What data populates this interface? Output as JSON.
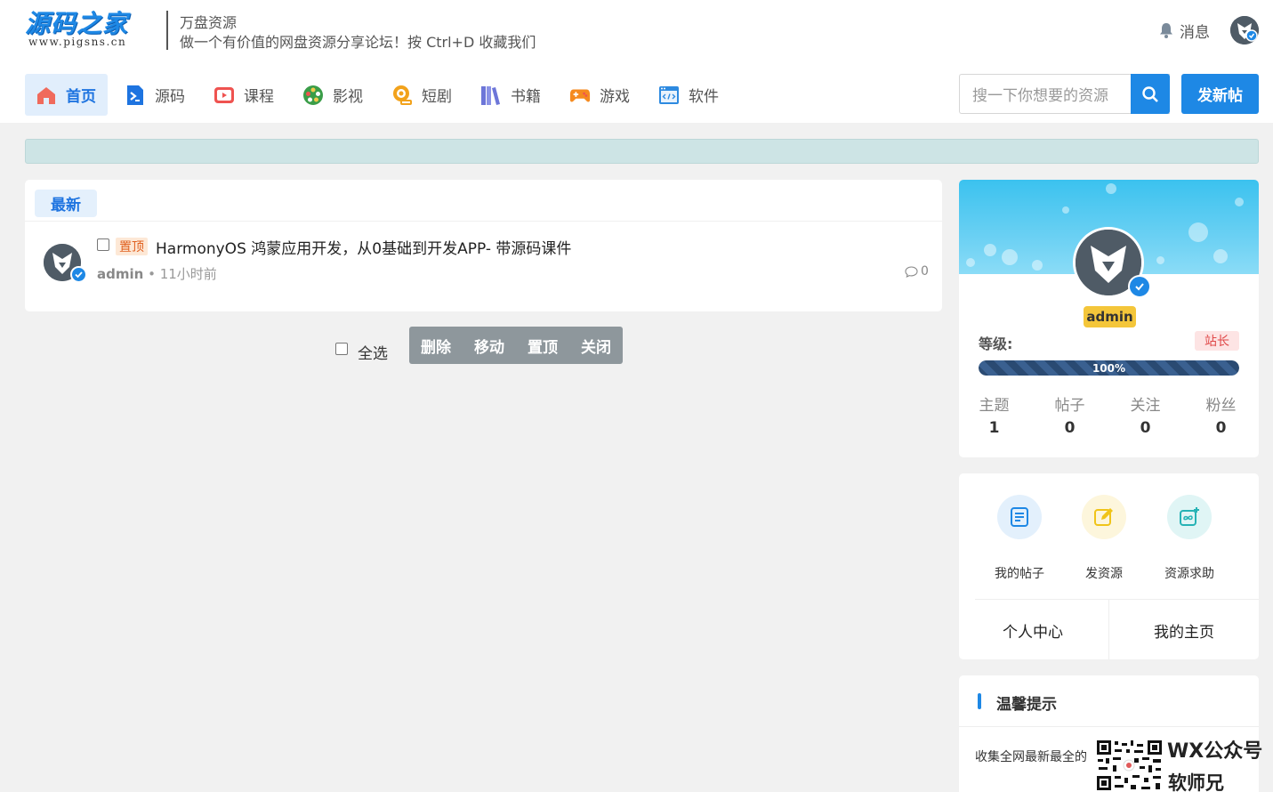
{
  "logo": {
    "main": "源码之家",
    "sub": "www.pigsns.cn"
  },
  "site": {
    "name": "万盘资源",
    "slogan": "做一个有价值的网盘资源分享论坛！按 Ctrl+D 收藏我们"
  },
  "header": {
    "messages_label": "消息"
  },
  "nav": [
    {
      "label": "首页",
      "icon": "home-icon",
      "active": true,
      "color": "#f06a5c"
    },
    {
      "label": "源码",
      "icon": "terminal-icon",
      "color": "#1e74e0"
    },
    {
      "label": "课程",
      "icon": "video-play-icon",
      "color": "#ef5350"
    },
    {
      "label": "影视",
      "icon": "film-reel-icon",
      "color": "#3a9d48"
    },
    {
      "label": "短剧",
      "icon": "camera-icon",
      "color": "#f2a21b"
    },
    {
      "label": "书籍",
      "icon": "books-icon",
      "color": "#6d76d8"
    },
    {
      "label": "游戏",
      "icon": "gamepad-icon",
      "color": "#f58a1f"
    },
    {
      "label": "软件",
      "icon": "code-window-icon",
      "color": "#2d8ae0"
    }
  ],
  "search": {
    "placeholder": "搜一下你想要的资源"
  },
  "post_button": "发新帖",
  "list": {
    "tab": "最新",
    "threads": [
      {
        "pin_label": "置顶",
        "title": "HarmonyOS 鸿蒙应用开发，从0基础到开发APP- 带源码课件",
        "author": "admin",
        "time": "11小时前",
        "comments": "0"
      }
    ]
  },
  "bulk": {
    "select_all": "全选",
    "actions": [
      "删除",
      "移动",
      "置顶",
      "关闭"
    ]
  },
  "profile": {
    "name": "admin",
    "level_label": "等级:",
    "role": "站长",
    "progress_text": "100%",
    "progress_value": 1.0,
    "stats": [
      {
        "label": "主题",
        "value": "1"
      },
      {
        "label": "帖子",
        "value": "0"
      },
      {
        "label": "关注",
        "value": "0"
      },
      {
        "label": "粉丝",
        "value": "0"
      }
    ]
  },
  "actions": {
    "items": [
      {
        "label": "我的帖子",
        "icon": "document-icon",
        "color": "#1e88e5",
        "bg": "#e3f0fc"
      },
      {
        "label": "发资源",
        "icon": "edit-icon",
        "color": "#f0c419",
        "bg": "#fdf6dc"
      },
      {
        "label": "资源求助",
        "icon": "image-add-icon",
        "color": "#26b3b5",
        "bg": "#e0f5f5"
      }
    ],
    "links": [
      "个人中心",
      "我的主页"
    ]
  },
  "tips": {
    "title": "温馨提示",
    "text": "收集全网最新最全的"
  },
  "watermark": {
    "line1": "WX公众号",
    "line2": "软师兄"
  }
}
